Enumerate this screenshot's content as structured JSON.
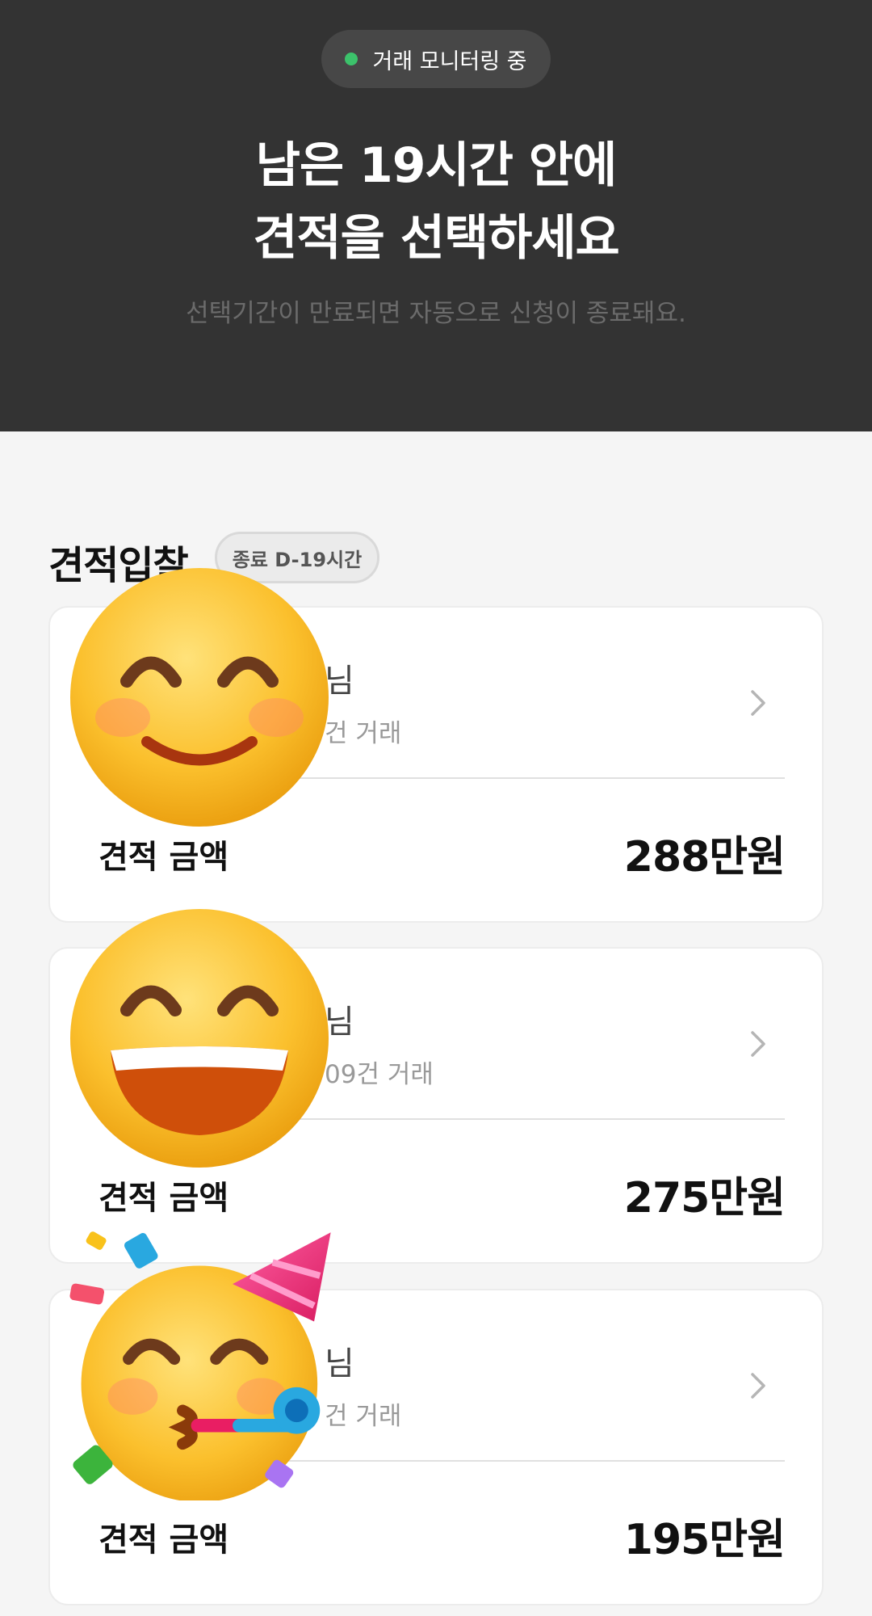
{
  "hero": {
    "status_label": "거래 모니터링 중",
    "status_color": "#3cc26b",
    "title_line1": "남은 19시간 안에",
    "title_line2": "견적을 선택하세요",
    "subtitle": "선택기간이 만료되면 자동으로 신청이 종료돼요."
  },
  "section": {
    "title": "견적입찰",
    "deadline_badge": "종료 D-19시간"
  },
  "bids": [
    {
      "name_suffix": "님",
      "meta": "건 거래",
      "amount_label": "견적 금액",
      "amount": "288만원",
      "avatar_icon": "smiling-face-with-smiling-eyes-emoji"
    },
    {
      "name_suffix": "님",
      "meta": "09건 거래",
      "amount_label": "견적 금액",
      "amount": "275만원",
      "avatar_icon": "grinning-face-with-smiling-eyes-emoji"
    },
    {
      "name_suffix": "님",
      "meta": "건 거래",
      "amount_label": "견적 금액",
      "amount": "195만원",
      "avatar_icon": "partying-face-emoji"
    }
  ]
}
